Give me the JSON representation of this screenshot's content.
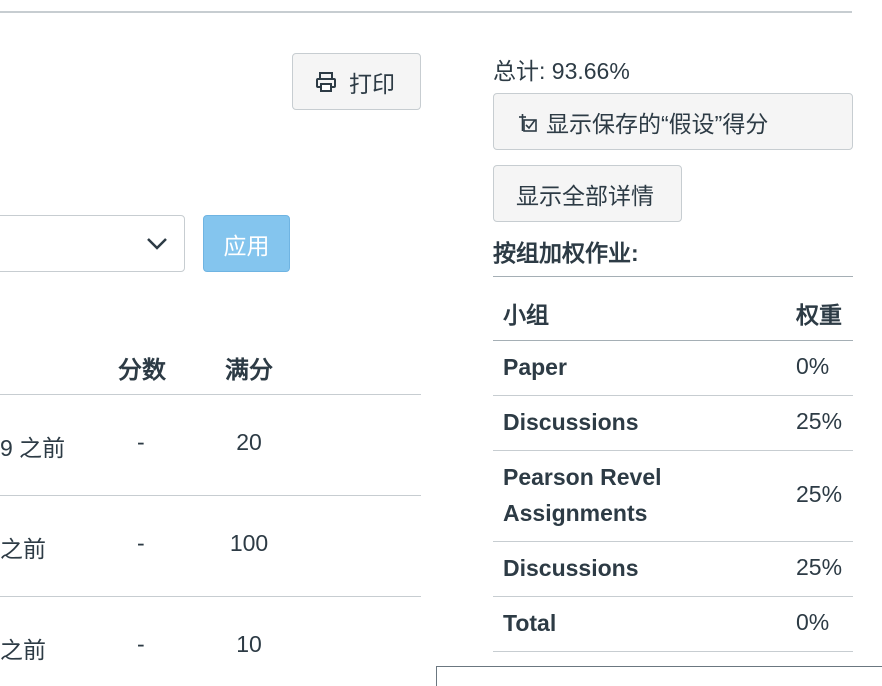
{
  "toolbar": {
    "print_label": "打印",
    "apply_label": "应用"
  },
  "grades_table": {
    "headers": {
      "score": "分数",
      "out_of": "满分"
    },
    "rows": [
      {
        "due": "9 之前",
        "score": "-",
        "out_of": "20"
      },
      {
        "due": "之前",
        "score": "-",
        "out_of": "100"
      },
      {
        "due": "之前",
        "score": "-",
        "out_of": "10"
      }
    ]
  },
  "sidebar": {
    "total": "总计: 93.66%",
    "whatif_label": "显示保存的“假设”得分",
    "details_label": "显示全部详情",
    "weighted_title": "按组加权作业:",
    "headers": {
      "group": "小组",
      "weight": "权重"
    },
    "groups": [
      {
        "name": "Paper",
        "weight": "0%"
      },
      {
        "name": "Discussions",
        "weight": "25%"
      },
      {
        "name": "Pearson Revel Assignments",
        "weight": "25%"
      },
      {
        "name": "Discussions",
        "weight": "25%"
      },
      {
        "name": "Total",
        "weight": "0%"
      }
    ]
  }
}
